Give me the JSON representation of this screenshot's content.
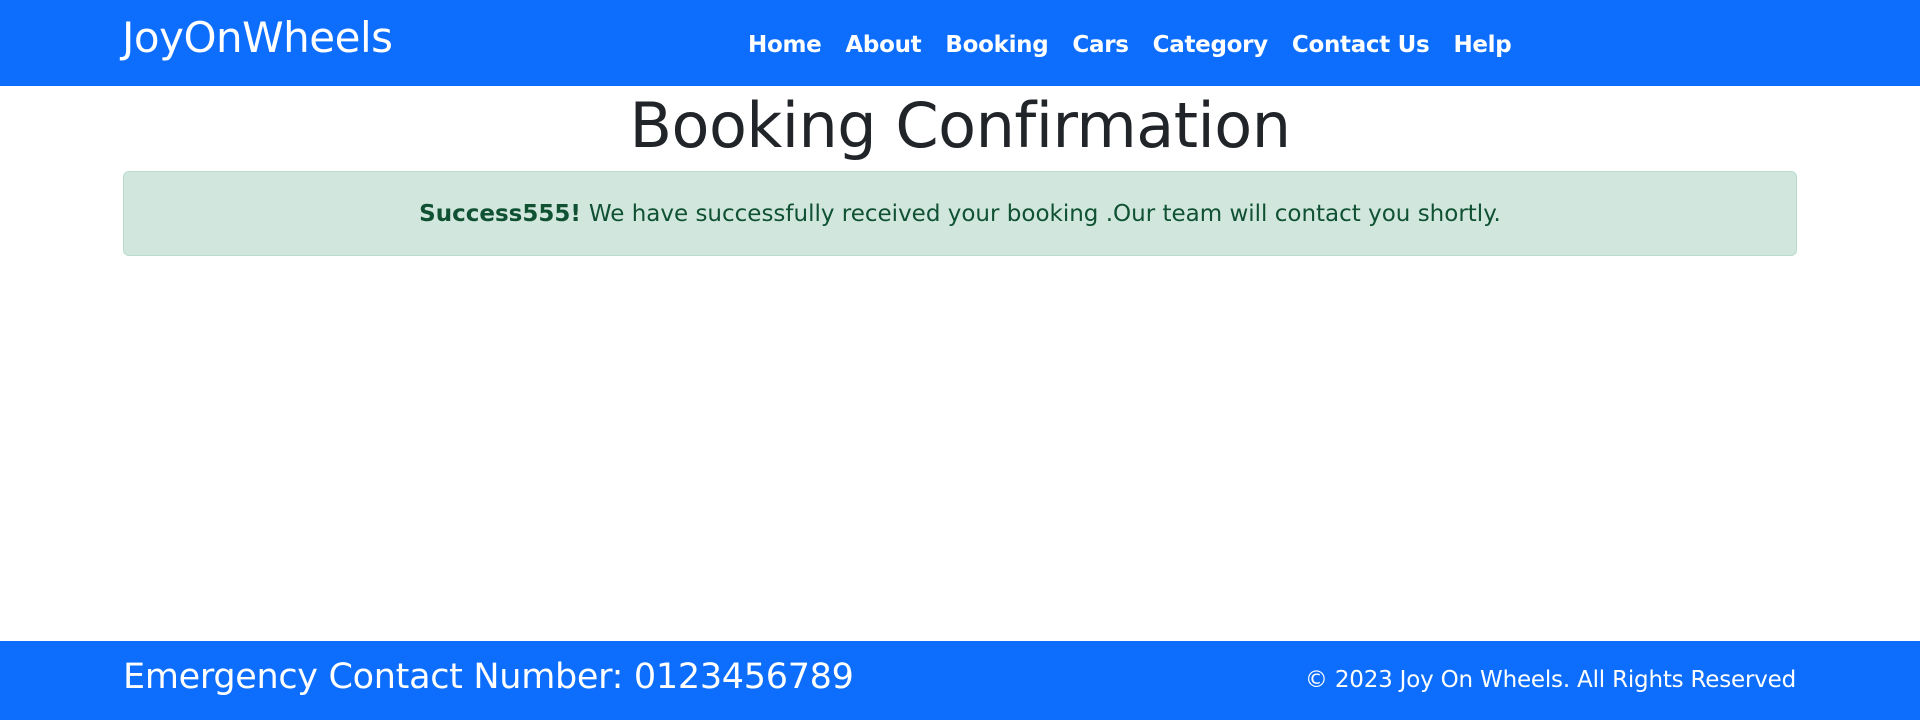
{
  "navbar": {
    "brand": "JoyOnWheels",
    "links": [
      {
        "label": "Home"
      },
      {
        "label": "About"
      },
      {
        "label": "Booking"
      },
      {
        "label": "Cars"
      },
      {
        "label": "Category"
      },
      {
        "label": "Contact Us"
      },
      {
        "label": "Help"
      }
    ],
    "background_color": "#0d6efd"
  },
  "main": {
    "title": "Booking Confirmation",
    "alert": {
      "strong_text": "Success555!",
      "message": "We have successfully received your booking .Our team will contact you shortly.",
      "background_color": "#d1e7dd",
      "text_color": "#0f5132"
    }
  },
  "footer": {
    "emergency_text": "Emergency Contact Number: 0123456789",
    "copyright": "© 2023 Joy On Wheels. All Rights Reserved",
    "background_color": "#0d6efd"
  }
}
